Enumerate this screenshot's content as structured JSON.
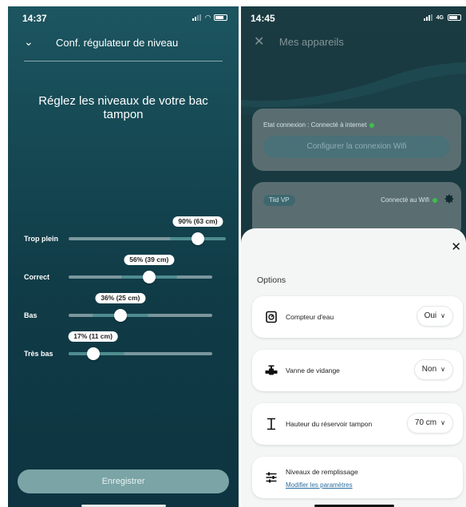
{
  "left": {
    "status": {
      "time": "14:37"
    },
    "header": {
      "title": "Conf. régulateur de niveau"
    },
    "heading": "Réglez les niveaux de votre bac tampon",
    "levels": [
      {
        "label": "Trop plein",
        "value": "90% (63 cm)",
        "percent": 90
      },
      {
        "label": "Correct",
        "value": "56% (39 cm)",
        "percent": 56
      },
      {
        "label": "Bas",
        "value": "36% (25 cm)",
        "percent": 36
      },
      {
        "label": "Très bas",
        "value": "17% (11 cm)",
        "percent": 17
      }
    ],
    "save_label": "Enregistrer"
  },
  "right": {
    "status": {
      "time": "14:45",
      "network": "4G"
    },
    "header": {
      "title": "Mes appareils"
    },
    "connection": {
      "text": "Etat connexion : Connecté à internet",
      "wifi_button": "Configurer la connexion Wifi"
    },
    "device": {
      "badge": "Tiid VP",
      "status": "Connecté au Wifi"
    },
    "sheet": {
      "title": "Options",
      "options": [
        {
          "icon": "water-meter-icon",
          "label": "Compteur d'eau",
          "value": "Oui"
        },
        {
          "icon": "drain-valve-icon",
          "label": "Vanne de vidange",
          "value": "Non"
        },
        {
          "icon": "tank-height-icon",
          "label": "Hauteur du réservoir tampon",
          "value": "70 cm"
        },
        {
          "icon": "sliders-icon",
          "label": "Niveaux de remplissage",
          "link": "Modifier les paramètres"
        }
      ]
    }
  },
  "colors": {
    "accent": "#4f8c90",
    "status_green": "#3fbf4a",
    "link": "#2c6ea0"
  }
}
